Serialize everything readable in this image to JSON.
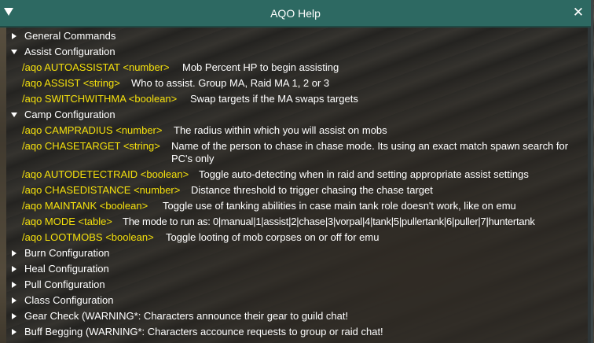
{
  "window": {
    "title": "AQO Help"
  },
  "tree": {
    "general": {
      "label": "General Commands"
    },
    "assist": {
      "label": "Assist Configuration",
      "items": [
        {
          "cmd": "/aqo AUTOASSISTAT <number>",
          "desc": "Mob Percent HP to begin assisting"
        },
        {
          "cmd": "/aqo ASSIST <string>",
          "desc": "Who to assist. Group MA, Raid MA 1, 2 or 3"
        },
        {
          "cmd": "/aqo SWITCHWITHMA <boolean>",
          "desc": "Swap targets if the MA swaps targets"
        }
      ]
    },
    "camp": {
      "label": "Camp Configuration",
      "items": [
        {
          "cmd": "/aqo CAMPRADIUS <number>",
          "desc": "The radius within which you will assist on mobs"
        },
        {
          "cmd": "/aqo CHASETARGET <string>",
          "desc": "Name of the person to chase in chase mode. Its using an exact match spawn search for PC's only"
        },
        {
          "cmd": "/aqo AUTODETECTRAID <boolean>",
          "desc": "Toggle auto-detecting when in raid and setting appropriate assist settings"
        },
        {
          "cmd": "/aqo CHASEDISTANCE <number>",
          "desc": "Distance threshold to trigger chasing the chase target"
        },
        {
          "cmd": "/aqo MAINTANK <boolean>",
          "desc": "Toggle use of tanking abilities in case main tank role doesn't work, like on emu"
        },
        {
          "cmd": "/aqo MODE <table>",
          "desc": "The mode to run as: 0|manual|1|assist|2|chase|3|vorpal|4|tank|5|pullertank|6|puller|7|huntertank"
        },
        {
          "cmd": "/aqo LOOTMOBS <boolean>",
          "desc": "Toggle looting of mob corpses on or off for emu"
        }
      ]
    },
    "burn": {
      "label": "Burn Configuration"
    },
    "heal": {
      "label": "Heal Configuration"
    },
    "pull": {
      "label": "Pull Configuration"
    },
    "class": {
      "label": "Class Configuration"
    },
    "gear": {
      "label": "Gear Check (WARNING*: Characters announce their gear to guild chat!"
    },
    "buff": {
      "label": "Buff Begging  (WARNING*: Characters accounce requests to group or raid chat!"
    }
  },
  "colors": {
    "titlebar": "#2d6962",
    "command": "#f4e00c",
    "text": "#ffffff"
  }
}
